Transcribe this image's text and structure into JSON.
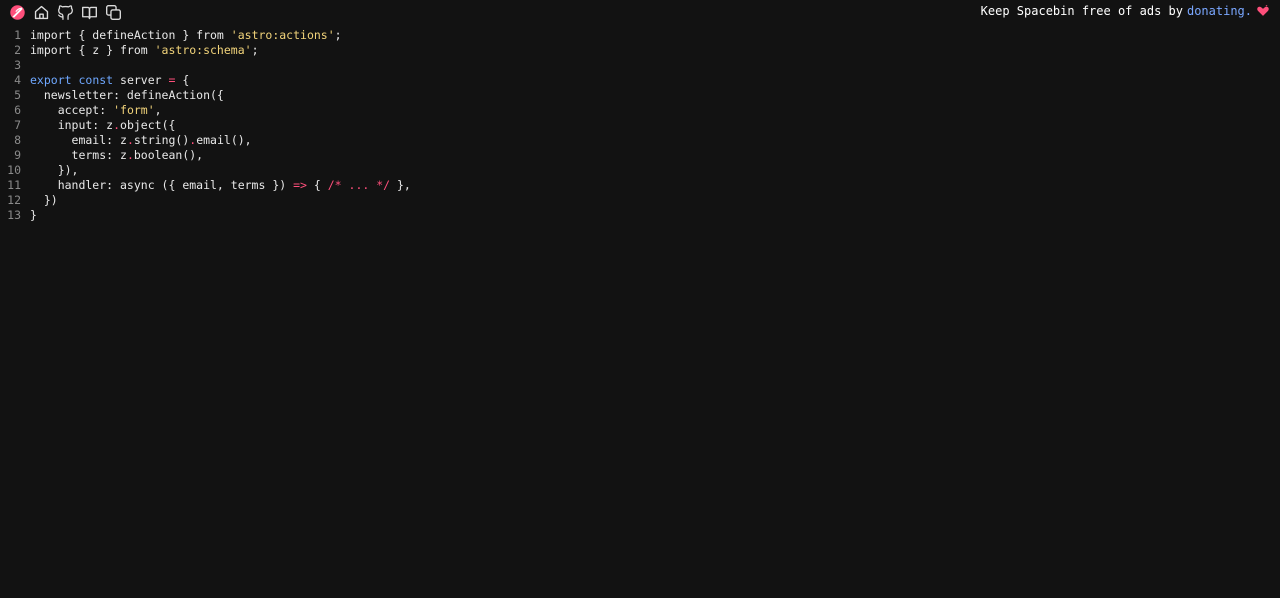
{
  "toolbar": {
    "icons": [
      "spacebin-logo-icon",
      "home-icon",
      "github-icon",
      "book-icon",
      "copy-icon"
    ],
    "ad_text_prefix": "Keep Spacebin free of ads by",
    "ad_link": "donating.",
    "heart_color": "#ff4f7b",
    "link_color": "#7aa7ff"
  },
  "code": {
    "line_numbers": [
      "1",
      "2",
      "3",
      "4",
      "5",
      "6",
      "7",
      "8",
      "9",
      "10",
      "11",
      "12",
      "13"
    ],
    "lines": [
      "import { defineAction } from 'astro:actions';",
      "import { z } from 'astro:schema';",
      "",
      "export const server = {",
      "  newsletter: defineAction({",
      "    accept: 'form',",
      "    input: z.object({",
      "      email: z.string().email(),",
      "      terms: z.boolean(),",
      "    }),",
      "    handler: async ({ email, terms }) => { /* ... */ },",
      "  })",
      "}"
    ]
  }
}
